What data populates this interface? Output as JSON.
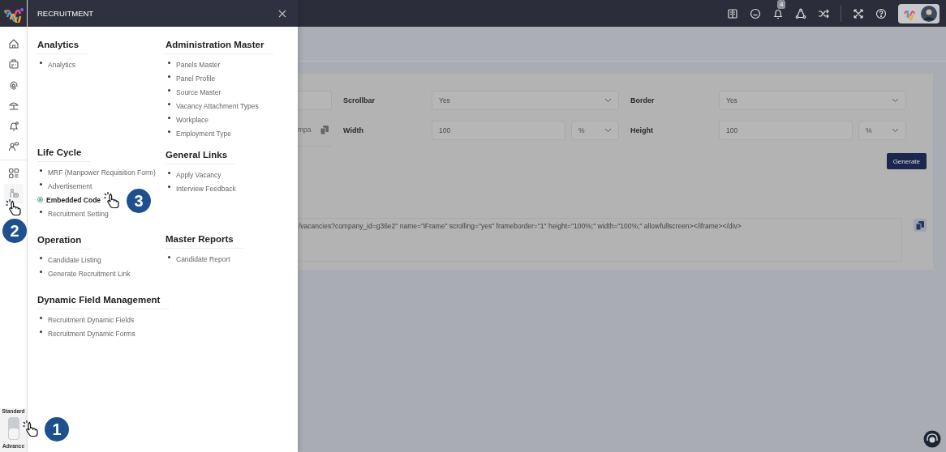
{
  "topbar": {
    "notification_count": "4",
    "icons": [
      {
        "kind": "book"
      },
      {
        "kind": "chat"
      },
      {
        "kind": "bell"
      },
      {
        "kind": "network"
      },
      {
        "kind": "shuffle"
      },
      {
        "kind": "expand"
      },
      {
        "kind": "help"
      }
    ]
  },
  "sidebar": {
    "items": [
      {
        "kind": "home",
        "selected": false
      },
      {
        "kind": "badge",
        "selected": false
      },
      {
        "kind": "fingerprint",
        "selected": false
      },
      {
        "kind": "umbrella",
        "selected": false
      },
      {
        "kind": "bell",
        "selected": false
      },
      {
        "kind": "people",
        "selected": false
      },
      {
        "kind": "grid",
        "selected": false
      },
      {
        "kind": "recruit",
        "selected": true
      }
    ],
    "mode_toggle": {
      "top_label": "Standard",
      "bottom_label": "Advance",
      "on": true
    }
  },
  "menu": {
    "title": "RECRUITMENT",
    "columns": [
      [
        {
          "heading": "Analytics",
          "items": [
            {
              "label": "Analytics",
              "selected": false
            }
          ]
        },
        {
          "heading": "Life Cycle",
          "items": [
            {
              "label": "MRF (Manpower Requisition Form)",
              "selected": false
            },
            {
              "label": "Advertisement",
              "selected": false
            },
            {
              "label": "Embedded Code",
              "selected": true
            },
            {
              "label": "Recruitment Setting",
              "selected": false
            }
          ]
        },
        {
          "heading": "Operation",
          "items": [
            {
              "label": "Candidate Listing",
              "selected": false
            },
            {
              "label": "Generate Recruitment Link",
              "selected": false
            }
          ]
        },
        {
          "heading": "Dynamic Field Management",
          "items": [
            {
              "label": "Recruitment Dynamic Fields",
              "selected": false
            },
            {
              "label": "Recruitment Dynamic Forms",
              "selected": false
            }
          ]
        }
      ],
      [
        {
          "heading": "Administration Master",
          "items": [
            {
              "label": "Panels Master",
              "selected": false
            },
            {
              "label": "Panel Profile",
              "selected": false
            },
            {
              "label": "Source Master",
              "selected": false
            },
            {
              "label": "Vacancy Attachment Types",
              "selected": false
            },
            {
              "label": "Workplace",
              "selected": false
            },
            {
              "label": "Employment Type",
              "selected": false
            }
          ]
        },
        {
          "heading": "General Links",
          "items": [
            {
              "label": "Apply Vacancy",
              "selected": false
            },
            {
              "label": "Interview Feedback",
              "selected": false
            }
          ]
        },
        {
          "heading": "Master Reports",
          "items": [
            {
              "label": "Candidate Report",
              "selected": false
            }
          ]
        }
      ]
    ]
  },
  "form": {
    "partial_field_text": "mpa",
    "scrollbar": {
      "label": "Scrollbar",
      "value": "Yes"
    },
    "border": {
      "label": "Border",
      "value": "Yes"
    },
    "width": {
      "label": "Width",
      "value": "100",
      "unit": "%"
    },
    "height": {
      "label": "Height",
      "value": "100",
      "unit": "%"
    },
    "generate_button": "Generate",
    "code": "/vacancies?company_id=g36e2\" name=\"iFrame\" scrolling=\"yes\" frameborder=\"1\" height=\"100%;\" width=\"100%;\" allowfullscreen></iframe></div>"
  },
  "annotations": [
    {
      "number": "1"
    },
    {
      "number": "2"
    },
    {
      "number": "3"
    }
  ]
}
